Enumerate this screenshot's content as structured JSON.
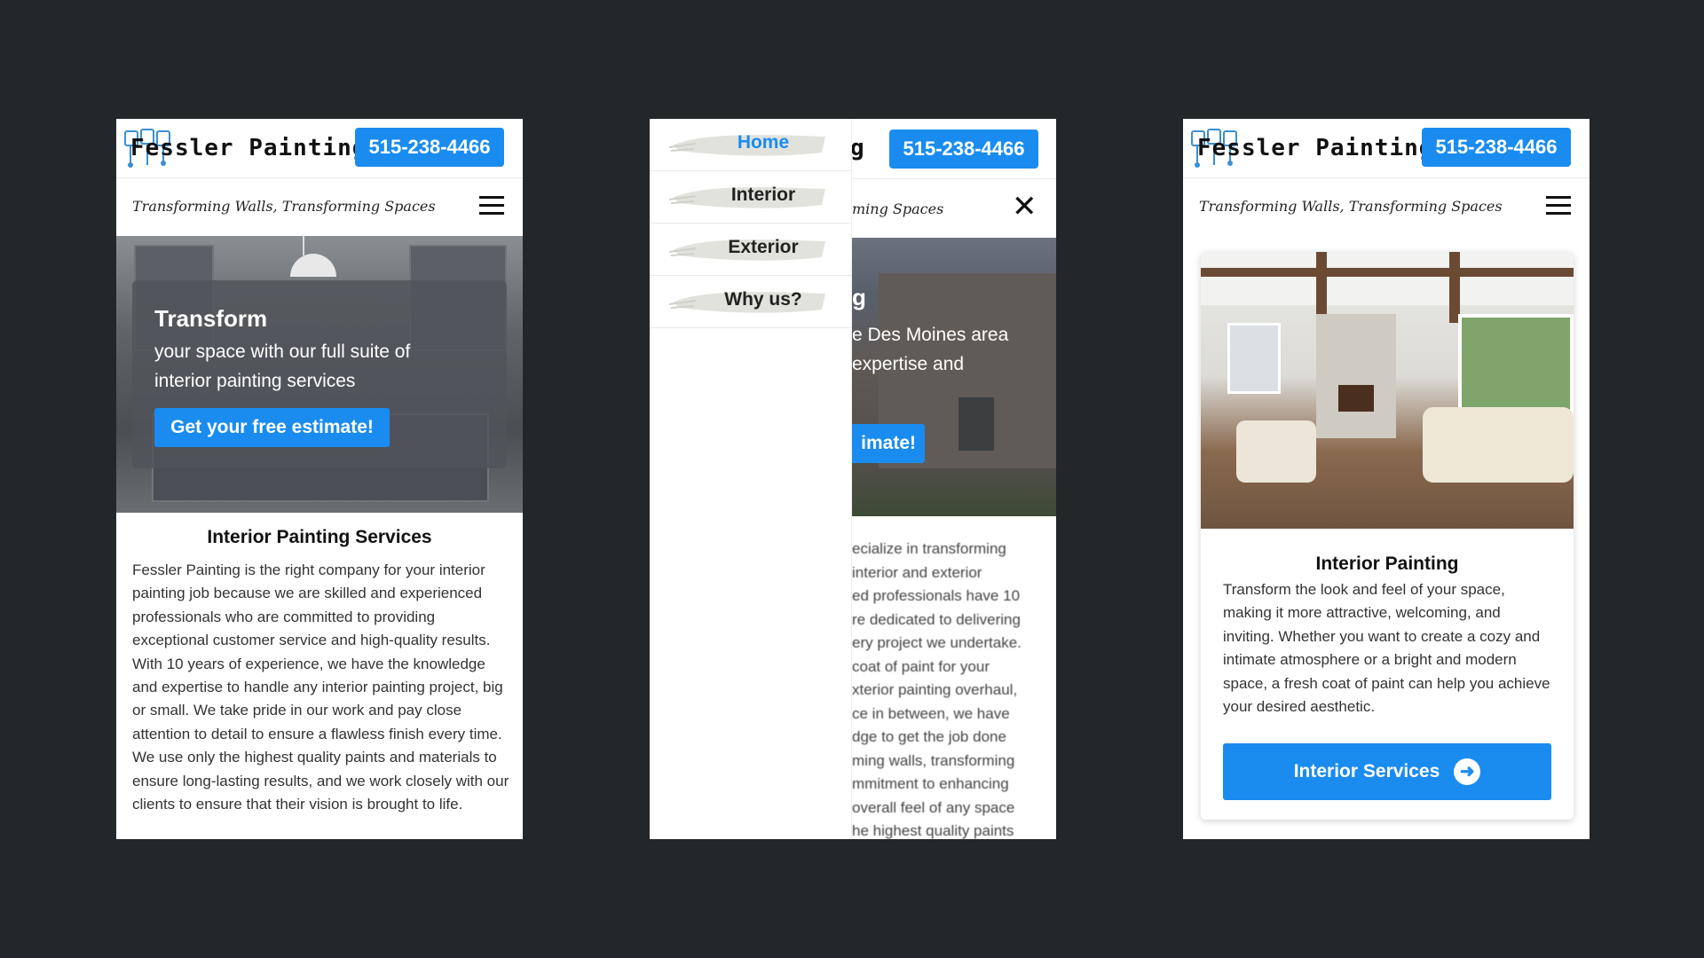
{
  "brand": {
    "name": "Fessler Painting",
    "phone": "515-238-4466",
    "tagline": "Transforming Walls, Transforming Spaces",
    "accent": "#1a8cf0",
    "logo_icon": "paint-brushes-logo-icon"
  },
  "screen1": {
    "hero_title": "Transform",
    "hero_text": "your space with our full suite of interior painting services",
    "estimate_button": "Get your free estimate!",
    "section_title": "Interior Painting Services",
    "section_body": "Fessler Painting is the right company for your interior painting job because we are skilled and experienced professionals who are committed to providing exceptional customer service and high-quality results. With 10 years of experience, we have the knowledge and expertise to handle any interior painting project, big or small. We take pride in our work and pay close attention to detail to ensure a flawless finish every time. We use only the highest quality paints and materials to ensure long-lasting results, and we work closely with our clients to ensure that their vision is brought to life."
  },
  "screen2": {
    "brand_tail": "g",
    "tagline_tail": "ming Spaces",
    "menu": [
      {
        "label": "Home",
        "active": true
      },
      {
        "label": "Interior",
        "active": false
      },
      {
        "label": "Exterior",
        "active": false
      },
      {
        "label": "Why us?",
        "active": false
      }
    ],
    "hero_line1": "g",
    "hero_line2": "e Des Moines area",
    "hero_line3": "expertise and",
    "estimate_tail": "imate!",
    "body_lines": [
      "ecialize in transforming",
      " interior and exterior",
      "ed professionals have 10",
      "re dedicated to delivering",
      "ery project we undertake.",
      " coat of paint for your",
      "xterior painting overhaul,",
      "ce in between, we have",
      "dge to get the job done",
      "ming walls, transforming",
      "mmitment to enhancing",
      "overall feel of any space",
      "he highest quality paints"
    ]
  },
  "screen3": {
    "card_title": "Interior Painting",
    "card_body": "Transform the look and feel of your space, making it more attractive, welcoming, and inviting. Whether you want to create a cozy and intimate atmosphere or a bright and modern space, a fresh coat of paint can help you achieve your desired aesthetic.",
    "button": "Interior Services"
  }
}
